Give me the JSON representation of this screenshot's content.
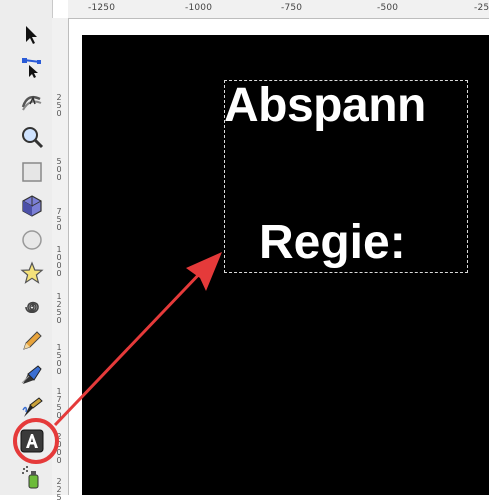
{
  "ruler": {
    "h_labels": [
      "-1250",
      "-1000",
      "-750",
      "-500",
      "-25"
    ],
    "v_labels": [
      "2\n5\n0",
      "5\n0\n0",
      "7\n5\n0",
      "1\n0\n0\n0",
      "1\n2\n5\n0",
      "1\n5\n0\n0",
      "1\n7\n5\n0",
      "2\n0\n0\n0",
      "2\n2\n5"
    ]
  },
  "tools": [
    {
      "name": "selector-tool",
      "icon": "arrow-pointer-icon"
    },
    {
      "name": "node-tool",
      "icon": "node-edit-icon"
    },
    {
      "name": "tweak-tool",
      "icon": "tweak-icon"
    },
    {
      "name": "zoom-tool",
      "icon": "magnifier-icon"
    },
    {
      "name": "rectangle-tool",
      "icon": "rectangle-icon"
    },
    {
      "name": "3d-box-tool",
      "icon": "cube-icon"
    },
    {
      "name": "ellipse-tool",
      "icon": "circle-icon"
    },
    {
      "name": "star-tool",
      "icon": "star-icon"
    },
    {
      "name": "spiral-tool",
      "icon": "spiral-icon"
    },
    {
      "name": "pencil-tool",
      "icon": "pencil-icon"
    },
    {
      "name": "pen-tool",
      "icon": "pen-icon"
    },
    {
      "name": "calligraphy-tool",
      "icon": "calligraphy-icon"
    },
    {
      "name": "text-tool",
      "icon": "text-a-icon"
    },
    {
      "name": "spray-tool",
      "icon": "spray-icon"
    }
  ],
  "canvas": {
    "text_line1": "Abspann",
    "text_line2": "Regie:"
  },
  "colors": {
    "page": "#000000",
    "annotation": "#e53a3a"
  }
}
